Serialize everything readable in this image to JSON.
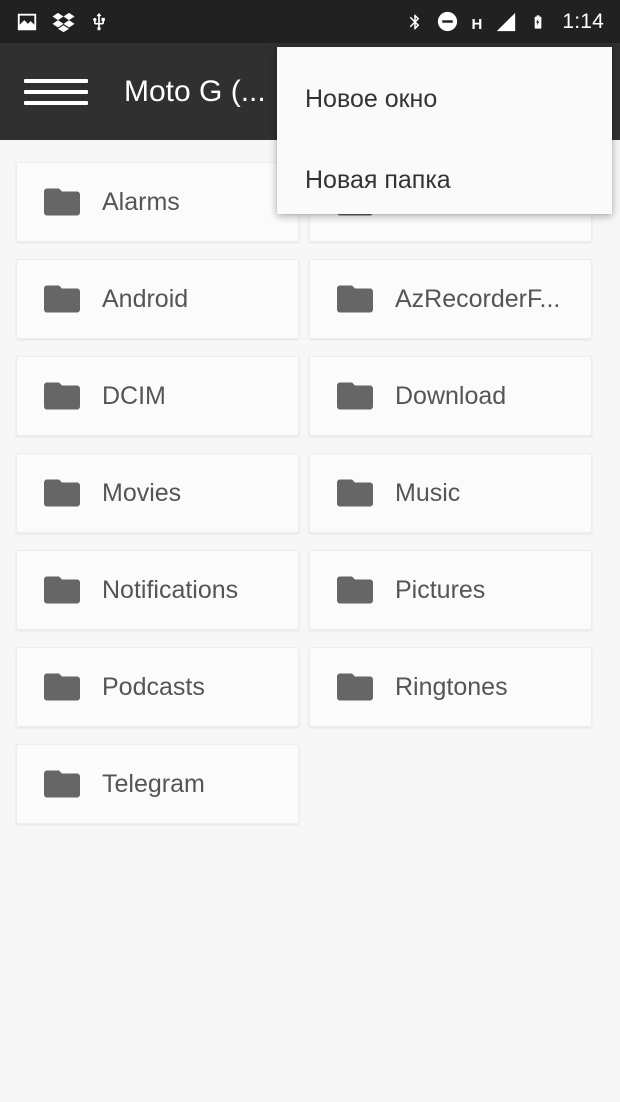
{
  "status_bar": {
    "background_color": "#212121",
    "left_icons": [
      {
        "name": "image-icon",
        "label": "Screenshot / image notification"
      },
      {
        "name": "dropbox-icon",
        "label": "Dropbox"
      },
      {
        "name": "usb-icon",
        "label": "USB connected"
      }
    ],
    "right_icons": [
      {
        "name": "bluetooth-icon",
        "label": "Bluetooth"
      },
      {
        "name": "do-not-disturb-icon",
        "label": "Do not disturb"
      },
      {
        "name": "network-type-icon",
        "label": "H"
      },
      {
        "name": "signal-bars-icon",
        "label": "Mobile signal"
      },
      {
        "name": "battery-charging-icon",
        "label": "Battery charging"
      }
    ],
    "network_type": "H",
    "clock": "1:14"
  },
  "app_bar": {
    "background_color": "#303030",
    "menu_icon": "hamburger-icon",
    "title": "Moto G (..."
  },
  "popup_menu": {
    "background_color": "#fafafa",
    "items": [
      {
        "label": "Новое окно",
        "name": "menu-item-new-window"
      },
      {
        "label": "Новая папка",
        "name": "menu-item-new-folder"
      }
    ]
  },
  "content": {
    "background_color": "#f7f7f7",
    "card_color": "#fbfbfb",
    "folder_icon_color": "#666666",
    "label_color": "#555555",
    "folders": [
      {
        "label": "Alarms",
        "icon": "folder-icon",
        "obscured": false
      },
      {
        "label": "",
        "icon": "folder-icon",
        "obscured": true
      },
      {
        "label": "Android",
        "icon": "folder-icon",
        "obscured": false
      },
      {
        "label": "AzRecorderF...",
        "icon": "folder-icon",
        "obscured": false
      },
      {
        "label": "DCIM",
        "icon": "folder-icon",
        "obscured": false
      },
      {
        "label": "Download",
        "icon": "folder-icon",
        "obscured": false
      },
      {
        "label": "Movies",
        "icon": "folder-icon",
        "obscured": false
      },
      {
        "label": "Music",
        "icon": "folder-icon",
        "obscured": false
      },
      {
        "label": "Notifications",
        "icon": "folder-icon",
        "obscured": false
      },
      {
        "label": "Pictures",
        "icon": "folder-icon",
        "obscured": false
      },
      {
        "label": "Podcasts",
        "icon": "folder-icon",
        "obscured": false
      },
      {
        "label": "Ringtones",
        "icon": "folder-icon",
        "obscured": false
      },
      {
        "label": "Telegram",
        "icon": "folder-icon",
        "obscured": false
      }
    ]
  }
}
